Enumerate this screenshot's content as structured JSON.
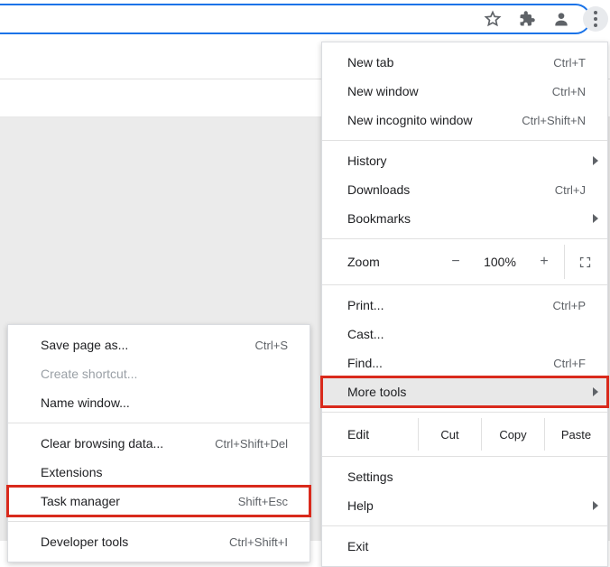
{
  "toolbar": {
    "star": "star-icon",
    "ext": "extensions-icon",
    "profile": "profile-icon",
    "more": "more-icon"
  },
  "menu": {
    "new_tab": {
      "label": "New tab",
      "shortcut": "Ctrl+T"
    },
    "new_window": {
      "label": "New window",
      "shortcut": "Ctrl+N"
    },
    "new_incognito": {
      "label": "New incognito window",
      "shortcut": "Ctrl+Shift+N"
    },
    "history": {
      "label": "History"
    },
    "downloads": {
      "label": "Downloads",
      "shortcut": "Ctrl+J"
    },
    "bookmarks": {
      "label": "Bookmarks"
    },
    "zoom": {
      "label": "Zoom",
      "minus": "−",
      "value": "100%",
      "plus": "+"
    },
    "print": {
      "label": "Print...",
      "shortcut": "Ctrl+P"
    },
    "cast": {
      "label": "Cast..."
    },
    "find": {
      "label": "Find...",
      "shortcut": "Ctrl+F"
    },
    "more_tools": {
      "label": "More tools"
    },
    "edit": {
      "label": "Edit",
      "cut": "Cut",
      "copy": "Copy",
      "paste": "Paste"
    },
    "settings": {
      "label": "Settings"
    },
    "help": {
      "label": "Help"
    },
    "exit": {
      "label": "Exit"
    }
  },
  "submenu": {
    "save_page": {
      "label": "Save page as...",
      "shortcut": "Ctrl+S"
    },
    "create_shortcut": {
      "label": "Create shortcut..."
    },
    "name_window": {
      "label": "Name window..."
    },
    "clear_data": {
      "label": "Clear browsing data...",
      "shortcut": "Ctrl+Shift+Del"
    },
    "extensions": {
      "label": "Extensions"
    },
    "task_manager": {
      "label": "Task manager",
      "shortcut": "Shift+Esc"
    },
    "dev_tools": {
      "label": "Developer tools",
      "shortcut": "Ctrl+Shift+I"
    }
  },
  "highlight_color": "#d92a1c"
}
